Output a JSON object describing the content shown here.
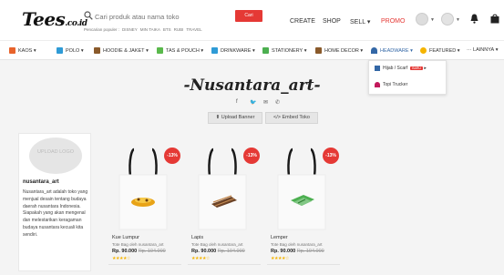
{
  "header": {
    "logo": "Tees",
    "logo_suffix": ".co.id",
    "search_placeholder": "Cari produk atau nama toko",
    "search_button": "Cari",
    "popular_label": "Pencarian populer :",
    "popular_terms": [
      "DISNEY",
      "MIN TAIKA",
      "BTS",
      "RUBI",
      "TRAVEL"
    ],
    "nav": {
      "create": "CREATE",
      "shop": "SHOP",
      "sell": "SELL",
      "promo": "PROMO"
    }
  },
  "categories": [
    "KAOS",
    "POLO",
    "HOODIE & JAKET",
    "TAS & POUCH",
    "DRINKWARE",
    "STATIONERY",
    "HOME DECOR",
    "HEADWARE",
    "FEATURED",
    "LAINNYA"
  ],
  "dropdown": {
    "items": [
      {
        "label": "Hijab / Scarf",
        "badge": "BARU"
      },
      {
        "label": "Topi Trucker"
      }
    ]
  },
  "store": {
    "title": "-Nusantara_art-",
    "upload_banner": "Upload Banner",
    "embed_toko": "</> Embed Toko",
    "upload_logo": "UPLOAD LOGO",
    "name": "nusantara_art",
    "description": "Nusantara_art adalah toko yang menjual desain tentang budaya daerah nusantara Indonesia. Siapakah yang akan mengenal dan melestarikan keragaman budaya nusantara kecuali kita sendiri."
  },
  "products": [
    {
      "name": "Kue Lumpur",
      "subtitle": "Tote Bag oleh nusantara_art",
      "price": "Rp. 90.000",
      "old_price": "Rp. 104.000",
      "discount": "-13%",
      "stars": "★★★★☆"
    },
    {
      "name": "Lapis",
      "subtitle": "Tote Bag oleh nusantara_art",
      "price": "Rp. 90.000",
      "old_price": "Rp. 104.000",
      "discount": "-13%",
      "stars": "★★★★☆"
    },
    {
      "name": "Lemper",
      "subtitle": "Tote Bag oleh nusantara_art",
      "price": "Rp. 90.000",
      "old_price": "Rp. 104.000",
      "discount": "-13%",
      "stars": "★★★★☆"
    }
  ],
  "colors": {
    "accent": "#e53935",
    "link_blue": "#3367a6",
    "star": "#f5b400"
  }
}
